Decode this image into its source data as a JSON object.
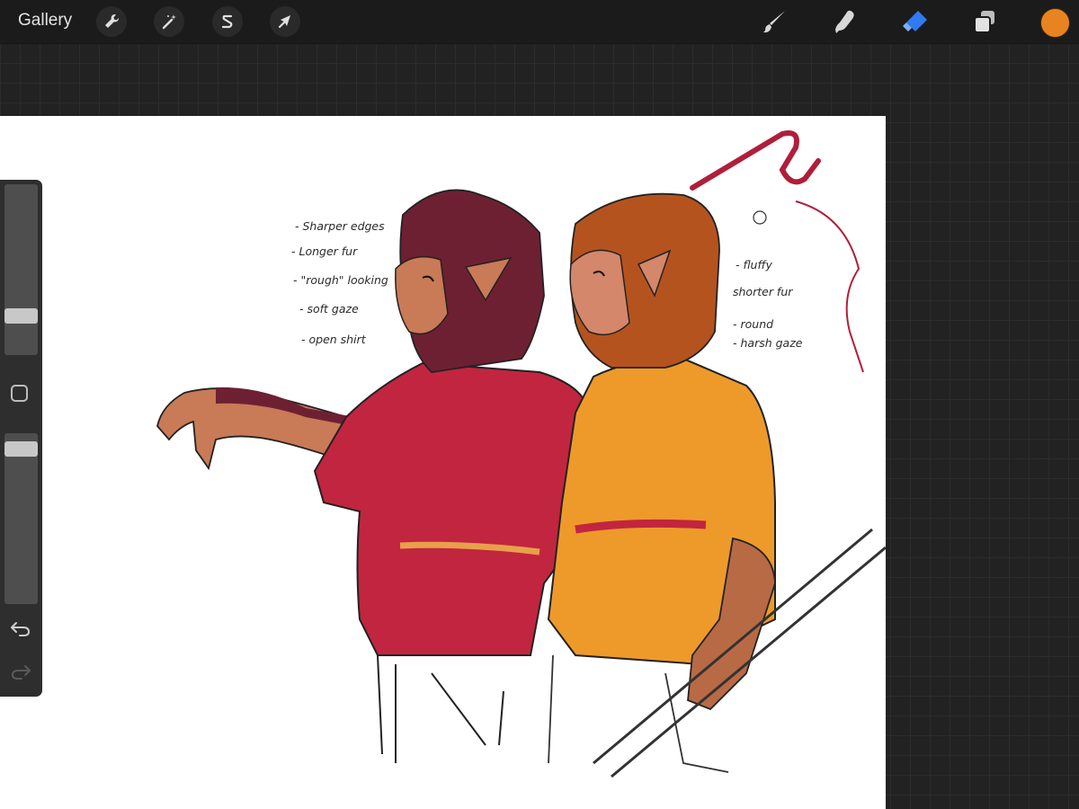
{
  "app": {
    "gallery_label": "Gallery"
  },
  "toolbar_left": {
    "icons": [
      "wrench-icon",
      "magic-wand-icon",
      "selection-icon",
      "transform-arrow-icon"
    ]
  },
  "toolbar_right": {
    "icons": [
      "brush-icon",
      "smudge-icon",
      "eraser-icon",
      "layers-icon"
    ],
    "active_tool": "eraser",
    "current_color": "#E8841F"
  },
  "sidebar": {
    "brush_size_level": 0.8,
    "opacity_level": 0.05,
    "icons": [
      "modify-square-icon",
      "undo-icon",
      "redo-icon"
    ]
  },
  "notes": {
    "left": [
      "- Sharper edges",
      "- Longer fur",
      "- \"rough\" looking",
      "- soft gaze",
      "- open shirt"
    ],
    "right": [
      "- fluffy",
      "shorter fur",
      "- round",
      "- harsh gaze"
    ]
  },
  "colors": {
    "accent_blue": "#2F7BF2",
    "robe_crimson": "#C2253F",
    "robe_orange": "#EE9A2A",
    "fur_dark": "#6E2033",
    "fur_orange": "#B5531E",
    "skin": "#C97A56"
  }
}
